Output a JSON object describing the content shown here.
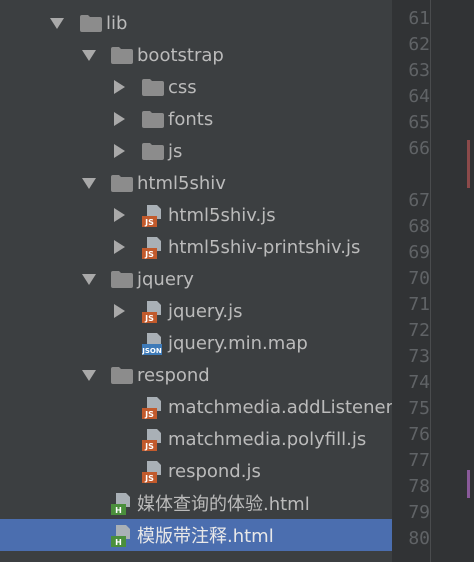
{
  "tree": [
    {
      "name": "lib",
      "type": "folder",
      "expanded": true,
      "depth": 0,
      "selected": false
    },
    {
      "name": "bootstrap",
      "type": "folder",
      "expanded": true,
      "depth": 1,
      "selected": false
    },
    {
      "name": "css",
      "type": "folder",
      "expanded": false,
      "depth": 2,
      "selected": false
    },
    {
      "name": "fonts",
      "type": "folder",
      "expanded": false,
      "depth": 2,
      "selected": false
    },
    {
      "name": "js",
      "type": "folder",
      "expanded": false,
      "depth": 2,
      "selected": false
    },
    {
      "name": "html5shiv",
      "type": "folder",
      "expanded": true,
      "depth": 1,
      "selected": false
    },
    {
      "name": "html5shiv.js",
      "type": "file",
      "file_icon": "js-file-icon",
      "expandable": true,
      "depth": 2,
      "selected": false
    },
    {
      "name": "html5shiv-printshiv.js",
      "type": "file",
      "file_icon": "js-file-icon",
      "expandable": true,
      "depth": 2,
      "selected": false
    },
    {
      "name": "jquery",
      "type": "folder",
      "expanded": true,
      "depth": 1,
      "selected": false
    },
    {
      "name": "jquery.js",
      "type": "file",
      "file_icon": "js-file-icon",
      "expandable": true,
      "depth": 2,
      "selected": false
    },
    {
      "name": "jquery.min.map",
      "type": "file",
      "file_icon": "json-file-icon",
      "expandable": false,
      "depth": 2,
      "selected": false
    },
    {
      "name": "respond",
      "type": "folder",
      "expanded": true,
      "depth": 1,
      "selected": false
    },
    {
      "name": "matchmedia.addListener.js",
      "type": "file",
      "file_icon": "js-file-icon",
      "expandable": false,
      "depth": 2,
      "selected": false
    },
    {
      "name": "matchmedia.polyfill.js",
      "type": "file",
      "file_icon": "js-file-icon",
      "expandable": false,
      "depth": 2,
      "selected": false
    },
    {
      "name": "respond.js",
      "type": "file",
      "file_icon": "js-file-icon",
      "expandable": false,
      "depth": 2,
      "selected": false
    },
    {
      "name": "媒体查询的体验.html",
      "type": "file",
      "file_icon": "html-file-icon",
      "expandable": false,
      "depth": 1,
      "selected": false
    },
    {
      "name": "模版带注释.html",
      "type": "file",
      "file_icon": "html-file-icon",
      "expandable": false,
      "depth": 1,
      "selected": true
    }
  ],
  "line_numbers": [
    "61",
    "62",
    "63",
    "64",
    "65",
    "66",
    "67",
    "68",
    "69",
    "70",
    "71",
    "72",
    "73",
    "74",
    "75",
    "76",
    "77",
    "78",
    "79",
    "80"
  ],
  "icon_badges": {
    "js": "JS",
    "json": "JSON",
    "html": "H"
  },
  "colors": {
    "panel_bg": "#3c3f41",
    "selection": "#4b6eaf",
    "text": "#bbbbbb",
    "folder": "#8c8c8c",
    "js_badge": "#c25a2c",
    "json_badge": "#3d7ab8",
    "html_badge": "#4a8f3c",
    "gutter_bg": "#313335",
    "line_number": "#606366"
  }
}
